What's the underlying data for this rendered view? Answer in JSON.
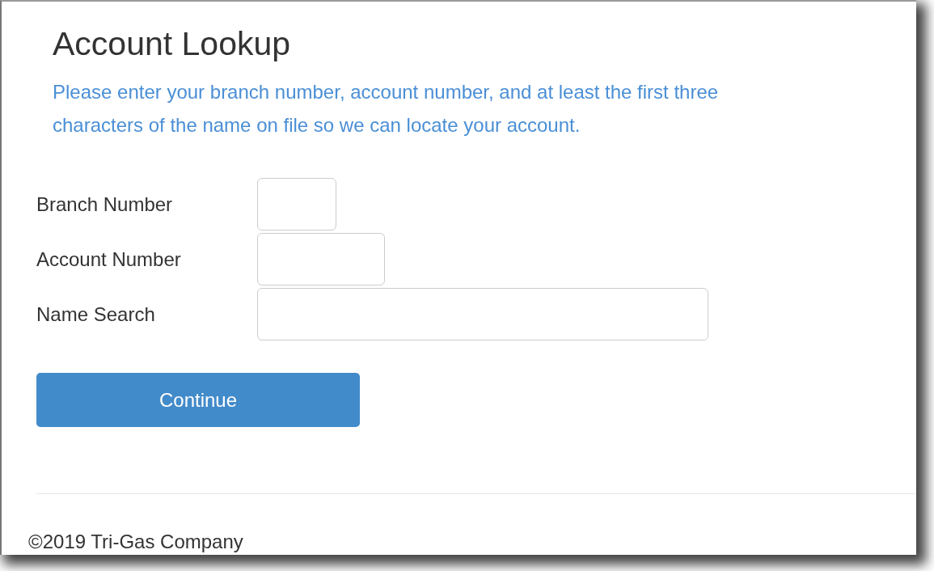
{
  "title": "Account Lookup",
  "instructions": "Please enter your branch number, account number, and at least the first three characters of the name on file so we can locate your account.",
  "fields": [
    {
      "label": "Branch Number"
    },
    {
      "label": "Account Number"
    },
    {
      "label": "Name Search"
    }
  ],
  "button": "Continue",
  "footer": "©2019 Tri-Gas Company"
}
